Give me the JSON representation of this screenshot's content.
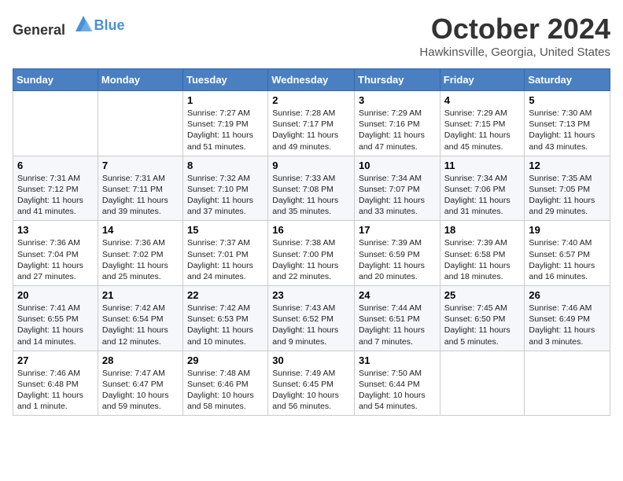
{
  "header": {
    "logo_general": "General",
    "logo_blue": "Blue",
    "month_title": "October 2024",
    "location": "Hawkinsville, Georgia, United States"
  },
  "weekdays": [
    "Sunday",
    "Monday",
    "Tuesday",
    "Wednesday",
    "Thursday",
    "Friday",
    "Saturday"
  ],
  "weeks": [
    [
      {
        "day": "",
        "sunrise": "",
        "sunset": "",
        "daylight": ""
      },
      {
        "day": "",
        "sunrise": "",
        "sunset": "",
        "daylight": ""
      },
      {
        "day": "1",
        "sunrise": "Sunrise: 7:27 AM",
        "sunset": "Sunset: 7:19 PM",
        "daylight": "Daylight: 11 hours and 51 minutes."
      },
      {
        "day": "2",
        "sunrise": "Sunrise: 7:28 AM",
        "sunset": "Sunset: 7:17 PM",
        "daylight": "Daylight: 11 hours and 49 minutes."
      },
      {
        "day": "3",
        "sunrise": "Sunrise: 7:29 AM",
        "sunset": "Sunset: 7:16 PM",
        "daylight": "Daylight: 11 hours and 47 minutes."
      },
      {
        "day": "4",
        "sunrise": "Sunrise: 7:29 AM",
        "sunset": "Sunset: 7:15 PM",
        "daylight": "Daylight: 11 hours and 45 minutes."
      },
      {
        "day": "5",
        "sunrise": "Sunrise: 7:30 AM",
        "sunset": "Sunset: 7:13 PM",
        "daylight": "Daylight: 11 hours and 43 minutes."
      }
    ],
    [
      {
        "day": "6",
        "sunrise": "Sunrise: 7:31 AM",
        "sunset": "Sunset: 7:12 PM",
        "daylight": "Daylight: 11 hours and 41 minutes."
      },
      {
        "day": "7",
        "sunrise": "Sunrise: 7:31 AM",
        "sunset": "Sunset: 7:11 PM",
        "daylight": "Daylight: 11 hours and 39 minutes."
      },
      {
        "day": "8",
        "sunrise": "Sunrise: 7:32 AM",
        "sunset": "Sunset: 7:10 PM",
        "daylight": "Daylight: 11 hours and 37 minutes."
      },
      {
        "day": "9",
        "sunrise": "Sunrise: 7:33 AM",
        "sunset": "Sunset: 7:08 PM",
        "daylight": "Daylight: 11 hours and 35 minutes."
      },
      {
        "day": "10",
        "sunrise": "Sunrise: 7:34 AM",
        "sunset": "Sunset: 7:07 PM",
        "daylight": "Daylight: 11 hours and 33 minutes."
      },
      {
        "day": "11",
        "sunrise": "Sunrise: 7:34 AM",
        "sunset": "Sunset: 7:06 PM",
        "daylight": "Daylight: 11 hours and 31 minutes."
      },
      {
        "day": "12",
        "sunrise": "Sunrise: 7:35 AM",
        "sunset": "Sunset: 7:05 PM",
        "daylight": "Daylight: 11 hours and 29 minutes."
      }
    ],
    [
      {
        "day": "13",
        "sunrise": "Sunrise: 7:36 AM",
        "sunset": "Sunset: 7:04 PM",
        "daylight": "Daylight: 11 hours and 27 minutes."
      },
      {
        "day": "14",
        "sunrise": "Sunrise: 7:36 AM",
        "sunset": "Sunset: 7:02 PM",
        "daylight": "Daylight: 11 hours and 25 minutes."
      },
      {
        "day": "15",
        "sunrise": "Sunrise: 7:37 AM",
        "sunset": "Sunset: 7:01 PM",
        "daylight": "Daylight: 11 hours and 24 minutes."
      },
      {
        "day": "16",
        "sunrise": "Sunrise: 7:38 AM",
        "sunset": "Sunset: 7:00 PM",
        "daylight": "Daylight: 11 hours and 22 minutes."
      },
      {
        "day": "17",
        "sunrise": "Sunrise: 7:39 AM",
        "sunset": "Sunset: 6:59 PM",
        "daylight": "Daylight: 11 hours and 20 minutes."
      },
      {
        "day": "18",
        "sunrise": "Sunrise: 7:39 AM",
        "sunset": "Sunset: 6:58 PM",
        "daylight": "Daylight: 11 hours and 18 minutes."
      },
      {
        "day": "19",
        "sunrise": "Sunrise: 7:40 AM",
        "sunset": "Sunset: 6:57 PM",
        "daylight": "Daylight: 11 hours and 16 minutes."
      }
    ],
    [
      {
        "day": "20",
        "sunrise": "Sunrise: 7:41 AM",
        "sunset": "Sunset: 6:55 PM",
        "daylight": "Daylight: 11 hours and 14 minutes."
      },
      {
        "day": "21",
        "sunrise": "Sunrise: 7:42 AM",
        "sunset": "Sunset: 6:54 PM",
        "daylight": "Daylight: 11 hours and 12 minutes."
      },
      {
        "day": "22",
        "sunrise": "Sunrise: 7:42 AM",
        "sunset": "Sunset: 6:53 PM",
        "daylight": "Daylight: 11 hours and 10 minutes."
      },
      {
        "day": "23",
        "sunrise": "Sunrise: 7:43 AM",
        "sunset": "Sunset: 6:52 PM",
        "daylight": "Daylight: 11 hours and 9 minutes."
      },
      {
        "day": "24",
        "sunrise": "Sunrise: 7:44 AM",
        "sunset": "Sunset: 6:51 PM",
        "daylight": "Daylight: 11 hours and 7 minutes."
      },
      {
        "day": "25",
        "sunrise": "Sunrise: 7:45 AM",
        "sunset": "Sunset: 6:50 PM",
        "daylight": "Daylight: 11 hours and 5 minutes."
      },
      {
        "day": "26",
        "sunrise": "Sunrise: 7:46 AM",
        "sunset": "Sunset: 6:49 PM",
        "daylight": "Daylight: 11 hours and 3 minutes."
      }
    ],
    [
      {
        "day": "27",
        "sunrise": "Sunrise: 7:46 AM",
        "sunset": "Sunset: 6:48 PM",
        "daylight": "Daylight: 11 hours and 1 minute."
      },
      {
        "day": "28",
        "sunrise": "Sunrise: 7:47 AM",
        "sunset": "Sunset: 6:47 PM",
        "daylight": "Daylight: 10 hours and 59 minutes."
      },
      {
        "day": "29",
        "sunrise": "Sunrise: 7:48 AM",
        "sunset": "Sunset: 6:46 PM",
        "daylight": "Daylight: 10 hours and 58 minutes."
      },
      {
        "day": "30",
        "sunrise": "Sunrise: 7:49 AM",
        "sunset": "Sunset: 6:45 PM",
        "daylight": "Daylight: 10 hours and 56 minutes."
      },
      {
        "day": "31",
        "sunrise": "Sunrise: 7:50 AM",
        "sunset": "Sunset: 6:44 PM",
        "daylight": "Daylight: 10 hours and 54 minutes."
      },
      {
        "day": "",
        "sunrise": "",
        "sunset": "",
        "daylight": ""
      },
      {
        "day": "",
        "sunrise": "",
        "sunset": "",
        "daylight": ""
      }
    ]
  ]
}
